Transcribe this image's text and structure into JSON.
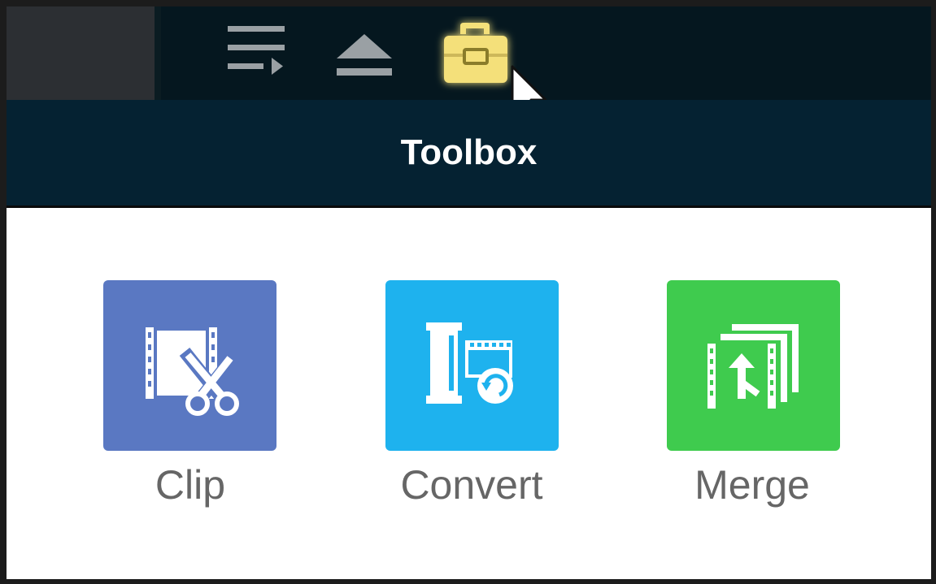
{
  "toolbar": {
    "icons": [
      {
        "name": "playlist-icon"
      },
      {
        "name": "eject-icon"
      },
      {
        "name": "toolbox-icon",
        "active_color": "#f4e07a"
      }
    ]
  },
  "panel": {
    "title": "Toolbox",
    "tools": [
      {
        "label": "Clip",
        "color": "#5a78c2",
        "icon": "clip-scissors-icon"
      },
      {
        "label": "Convert",
        "color": "#1eb2ee",
        "icon": "convert-film-icon"
      },
      {
        "label": "Merge",
        "color": "#3fcb4e",
        "icon": "merge-film-icon"
      }
    ]
  },
  "colors": {
    "topbar": "#05171f",
    "header": "#052232",
    "label": "#666666"
  }
}
